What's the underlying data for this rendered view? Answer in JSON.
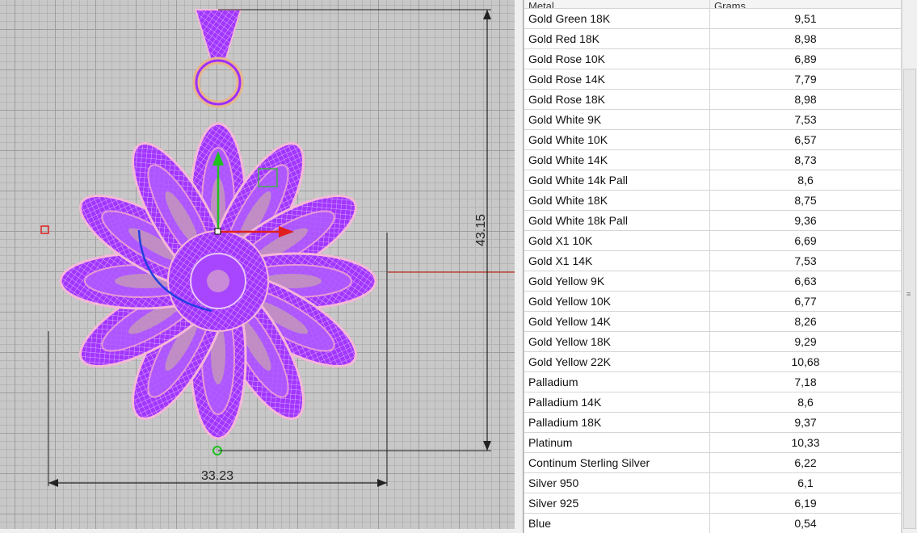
{
  "viewport": {
    "dimension_height": "43.15",
    "dimension_width": "33.23",
    "colors": {
      "model": "#9b30ff",
      "model_highlight": "#f5b8d8",
      "x_axis": "#e02020",
      "y_axis": "#20c020",
      "rotation_arc": "#2040e0",
      "dimension_line": "#222222"
    }
  },
  "table": {
    "headers": [
      "Metal",
      "Grams"
    ],
    "rows": [
      {
        "metal": "Gold Green 18K",
        "grams": "9,51"
      },
      {
        "metal": "Gold Red 18K",
        "grams": "8,98"
      },
      {
        "metal": "Gold Rose 10K",
        "grams": "6,89"
      },
      {
        "metal": "Gold Rose 14K",
        "grams": "7,79"
      },
      {
        "metal": "Gold Rose 18K",
        "grams": "8,98"
      },
      {
        "metal": "Gold White 9K",
        "grams": "7,53"
      },
      {
        "metal": "Gold White 10K",
        "grams": "6,57"
      },
      {
        "metal": "Gold White 14K",
        "grams": "8,73"
      },
      {
        "metal": "Gold White 14k Pall",
        "grams": "8,6"
      },
      {
        "metal": "Gold White 18K",
        "grams": "8,75"
      },
      {
        "metal": "Gold White 18k Pall",
        "grams": "9,36"
      },
      {
        "metal": "Gold X1 10K",
        "grams": "6,69"
      },
      {
        "metal": "Gold X1 14K",
        "grams": "7,53"
      },
      {
        "metal": "Gold Yellow 9K",
        "grams": "6,63"
      },
      {
        "metal": "Gold Yellow 10K",
        "grams": "6,77"
      },
      {
        "metal": "Gold Yellow 14K",
        "grams": "8,26"
      },
      {
        "metal": "Gold Yellow 18K",
        "grams": "9,29"
      },
      {
        "metal": "Gold Yellow 22K",
        "grams": "10,68"
      },
      {
        "metal": "Palladium",
        "grams": "7,18"
      },
      {
        "metal": "Palladium 14K",
        "grams": "8,6"
      },
      {
        "metal": "Palladium 18K",
        "grams": "9,37"
      },
      {
        "metal": "Platinum",
        "grams": "10,33"
      },
      {
        "metal": "Continum Sterling Silver",
        "grams": "6,22"
      },
      {
        "metal": "Silver 950",
        "grams": "6,1"
      },
      {
        "metal": "Silver 925",
        "grams": "6,19"
      },
      {
        "metal": "Blue",
        "grams": "0,54"
      }
    ]
  }
}
